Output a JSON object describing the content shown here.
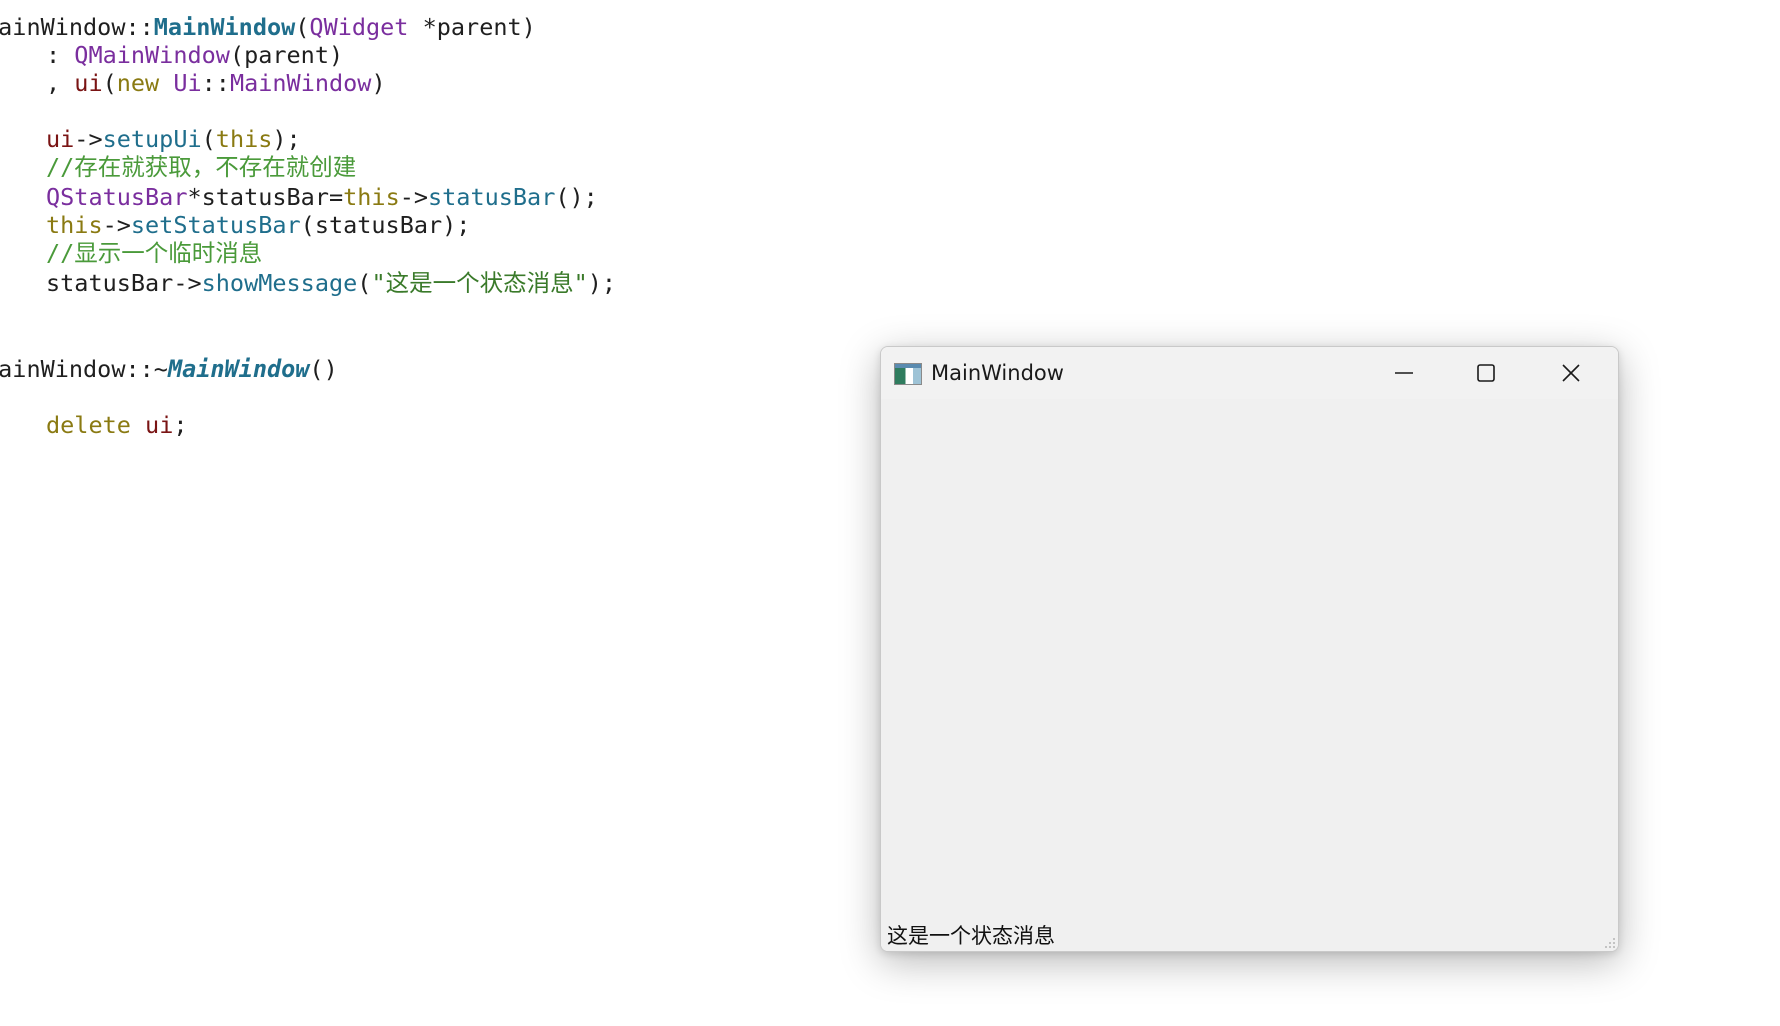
{
  "code": {
    "l1": {
      "cls": "MainWindow",
      "sep": "::",
      "ctor": "MainWindow",
      "open": "(",
      "ptype": "QWidget",
      "pname": " *parent",
      "close": ")"
    },
    "l2": {
      "colon": ": ",
      "base": "QMainWindow",
      "args": "(parent)"
    },
    "l3": {
      "comma": ", ",
      "member": "ui",
      "open": "(",
      "kw": "new",
      "sp": " ",
      "ns": "Ui",
      "sep": "::",
      "type": "MainWindow",
      "close": ")"
    },
    "l4": {
      "brace": "{"
    },
    "l5": {
      "obj": "ui",
      "arrow": "->",
      "fn": "setupUi",
      "open": "(",
      "kw": "this",
      "close": ");"
    },
    "l6": {
      "comment": "//存在就获取，不存在就创建"
    },
    "l7": {
      "type": "QStatusBar",
      "star": "*statusBar=",
      "kw": "this",
      "arrow": "->",
      "fn": "statusBar",
      "close": "();"
    },
    "l8": {
      "kw": "this",
      "arrow": "->",
      "fn": "setStatusBar",
      "args": "(statusBar);"
    },
    "l9": {
      "comment": "//显示一个临时消息"
    },
    "l10": {
      "obj": "statusBar",
      "arrow": "->",
      "fn": "showMessage",
      "open": "(",
      "str": "\"这是一个状态消息\"",
      "close": ");"
    },
    "l11": {
      "brace": "}"
    },
    "l12": {
      "cls": "MainWindow",
      "sep": "::~",
      "dtor": "MainWindow",
      "parens": "()"
    },
    "l13": {
      "brace": "{"
    },
    "l14": {
      "kw": "delete",
      "sp": " ",
      "member": "ui",
      "semi": ";"
    },
    "l15": {
      "brace": "}"
    }
  },
  "window": {
    "title": "MainWindow",
    "icons": {
      "app": "app-icon",
      "minimize": "minimize-icon",
      "maximize": "maximize-icon",
      "close": "close-icon",
      "grip": "size-grip-icon"
    },
    "status_message": "这是一个状态消息"
  },
  "colors": {
    "window_bg": "#f0f0f0",
    "type": "#7a2e9e",
    "function": "#1f6e8c",
    "keyword": "#8a7a12",
    "comment": "#4a9a3a",
    "member": "#7a1414"
  }
}
